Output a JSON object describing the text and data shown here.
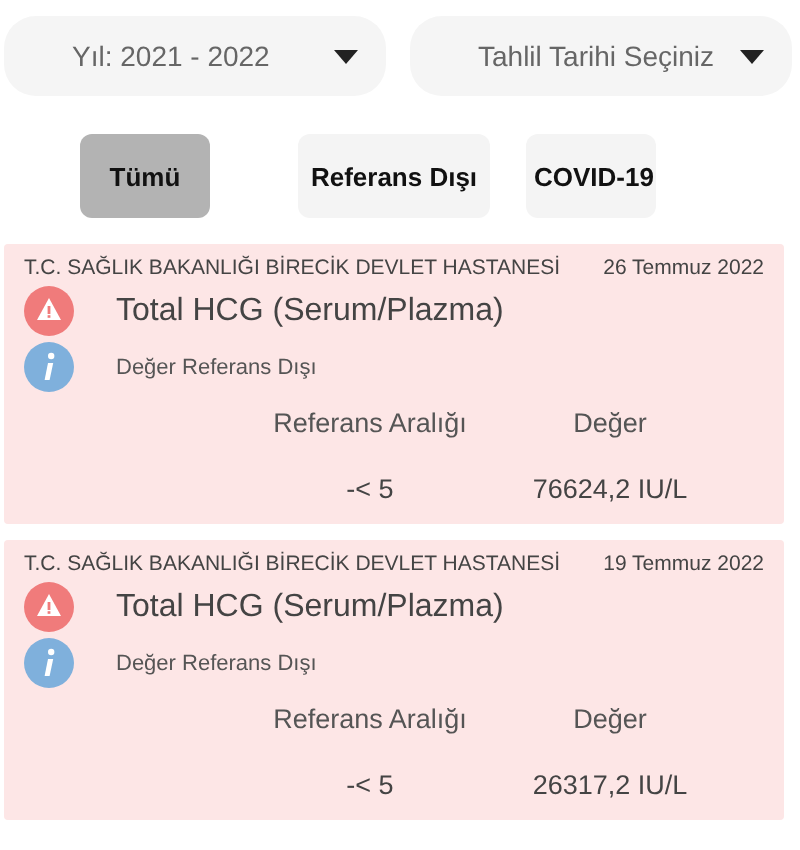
{
  "dropdowns": [
    {
      "value": "Yıl: 2021 - 2022"
    },
    {
      "value": "Tahlil Tarihi Seçiniz"
    }
  ],
  "filters": [
    {
      "label": "Tümü",
      "selected": true
    },
    {
      "label": "Referans Dışı",
      "selected": false
    },
    {
      "label": "COVID-19",
      "selected": false
    }
  ],
  "results": [
    {
      "hospital": "T.C. SAĞLIK BAKANLIĞI BİRECİK DEVLET HASTANESİ",
      "date": "26 Temmuz 2022",
      "test": "Total HCG (Serum/Plazma)",
      "status": "Değer Referans Dışı",
      "range_label": "Referans Aralığı",
      "value_label": "Değer",
      "range": "-< 5",
      "value": "76624,2 IU/L"
    },
    {
      "hospital": "T.C. SAĞLIK BAKANLIĞI BİRECİK DEVLET HASTANESİ",
      "date": "19 Temmuz 2022",
      "test": "Total HCG (Serum/Plazma)",
      "status": "Değer Referans Dışı",
      "range_label": "Referans Aralığı",
      "value_label": "Değer",
      "range": "-< 5",
      "value": "26317,2 IU/L"
    }
  ]
}
